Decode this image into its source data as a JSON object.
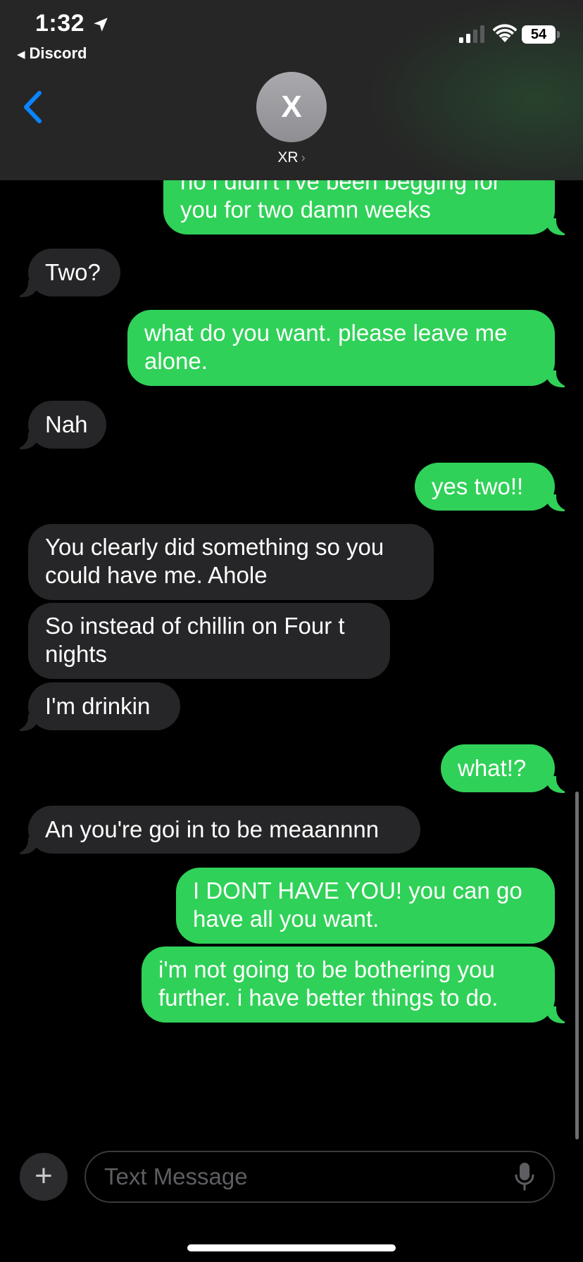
{
  "status_bar": {
    "time": "1:32",
    "battery": "54",
    "back_app": "Discord"
  },
  "contact": {
    "avatar_letter": "X",
    "name": "XR",
    "chevron": "›"
  },
  "messages": [
    {
      "dir": "out",
      "text": "no i didn't i've been begging for you for two damn weeks"
    },
    {
      "dir": "in",
      "text": "Two?"
    },
    {
      "dir": "out",
      "text": "what do you want. please leave me alone."
    },
    {
      "dir": "in",
      "text": "Nah"
    },
    {
      "dir": "out",
      "text": "yes two!!"
    },
    {
      "dir": "in",
      "text": "You clearly did something so you could have me. Ahole"
    },
    {
      "dir": "in",
      "text": "So instead of chillin on Four t nights"
    },
    {
      "dir": "in",
      "text": "I'm drinkin"
    },
    {
      "dir": "out",
      "text": "what!?"
    },
    {
      "dir": "in",
      "text": "An you're goi in to be meaannnn"
    },
    {
      "dir": "out",
      "text": "I DONT HAVE YOU! you can go have all you want."
    },
    {
      "dir": "out",
      "text": "i'm not going to be bothering you further. i have better things to do."
    }
  ],
  "composer": {
    "placeholder": "Text Message",
    "plus_label": "+"
  },
  "colors": {
    "outgoing_bubble": "#30d158",
    "incoming_bubble": "#262628",
    "accent": "#0a84ff"
  },
  "icons": [
    "location-arrow-icon",
    "cellular-signal-icon",
    "wifi-icon",
    "battery-icon",
    "chevron-left-icon",
    "plus-icon",
    "microphone-icon"
  ]
}
